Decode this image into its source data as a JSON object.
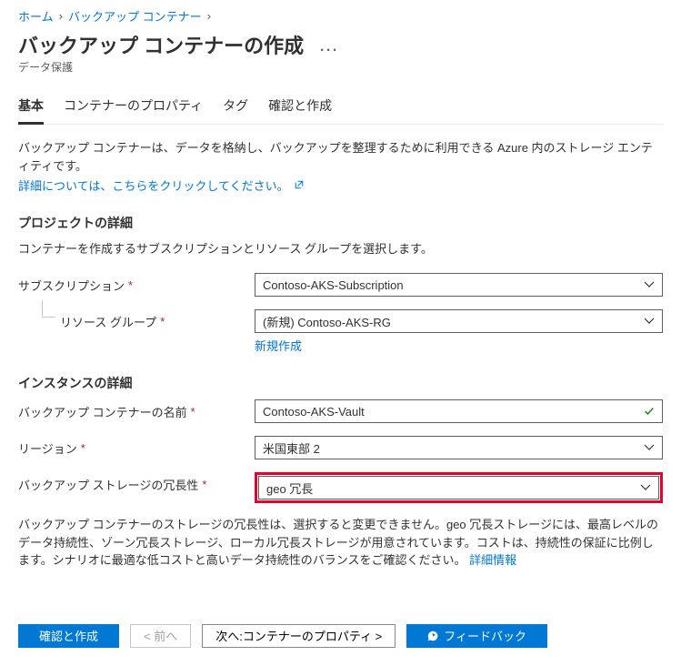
{
  "breadcrumb": {
    "home": "ホーム",
    "container": "バックアップ コンテナー"
  },
  "page": {
    "title": "バックアップ コンテナーの作成",
    "subtitle": "データ保護",
    "ellipsis": "…"
  },
  "tabs": {
    "basic": "基本",
    "properties": "コンテナーのプロパティ",
    "tags": "タグ",
    "review": "確認と作成"
  },
  "intro": {
    "line": "バックアップ コンテナーは、データを格納し、バックアップを整理するために利用できる Azure 内のストレージ エンティティです。",
    "more_link": "詳細については、こちらをクリックしてください。"
  },
  "project": {
    "heading": "プロジェクトの詳細",
    "sub": "コンテナーを作成するサブスクリプションとリソース グループを選択します。",
    "subscription_label": "サブスクリプション",
    "subscription_value": "Contoso-AKS-Subscription",
    "rg_label": "リソース グループ",
    "rg_value": "(新規) Contoso-AKS-RG",
    "rg_create_new": "新規作成"
  },
  "instance": {
    "heading": "インスタンスの詳細",
    "vault_name_label": "バックアップ コンテナーの名前",
    "vault_name_value": "Contoso-AKS-Vault",
    "region_label": "リージョン",
    "region_value": "米国東部 2",
    "redundancy_label": "バックアップ ストレージの冗長性",
    "redundancy_value": "geo 冗長"
  },
  "footer_desc": {
    "text": "バックアップ コンテナーのストレージの冗長性は、選択すると変更できません。geo 冗長ストレージには、最高レベルのデータ持続性、ゾーン冗長ストレージ、ローカル冗長ストレージが用意されています。コストは、持続性の保証に比例します。シナリオに最適な低コストと高いデータ持続性のバランスをご確認ください。",
    "link": "詳細情報"
  },
  "buttons": {
    "review_create": "確認と作成",
    "prev": "< 前へ",
    "next": "次へ:コンテナーのプロパティ >",
    "feedback": "フィードバック"
  }
}
